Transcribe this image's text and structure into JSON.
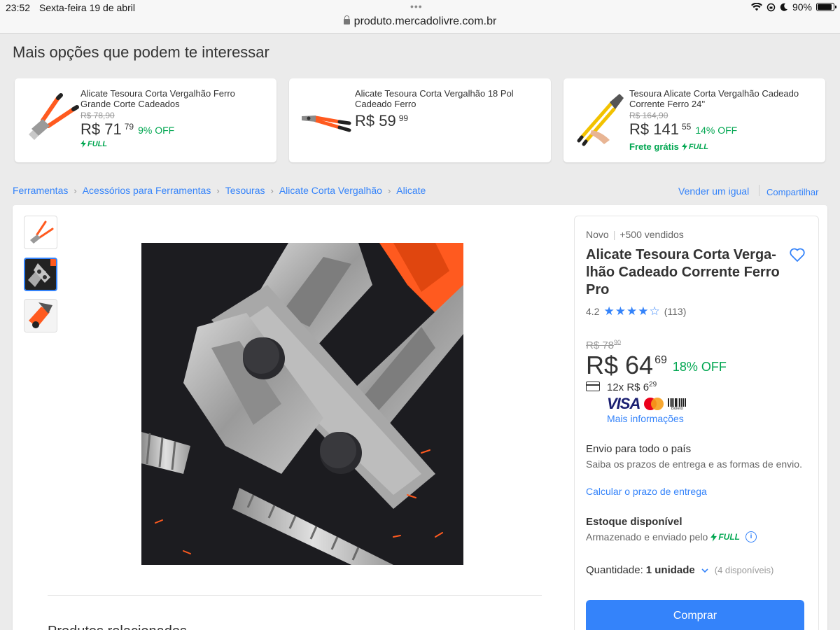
{
  "status_bar": {
    "time": "23:52",
    "date": "Sexta-feira 19 de abril",
    "battery": "90%",
    "battery_level": 0.9
  },
  "browser": {
    "url": "produto.mercadolivre.com.br"
  },
  "recommendations": {
    "title": "Mais opções que podem te interessar",
    "items": [
      {
        "title": "Alicate Tesoura Corta Vergalhão Ferro Grande Corte Cadeados",
        "old_price": "R$ 78,90",
        "price": "R$ 71",
        "cents": "79",
        "off": "9% OFF",
        "full": "FULL"
      },
      {
        "title": "Alicate Tesoura Corta Vergalhão 18 Pol Cadeado Ferro",
        "price": "R$ 59",
        "cents": "99"
      },
      {
        "title": "Tesoura Alicate Corta Vergalhão Cadeado Corrente Ferro 24''",
        "old_price": "R$ 164,90",
        "price": "R$ 141",
        "cents": "55",
        "off": "14% OFF",
        "frete": "Frete grátis",
        "full": "FULL"
      }
    ]
  },
  "breadcrumb": [
    "Ferramentas",
    "Acessórios para Ferramentas",
    "Tesouras",
    "Alicate Corta Vergalhão",
    "Alicate"
  ],
  "actions": {
    "sell": "Vender um igual",
    "share": "Compartilhar"
  },
  "product": {
    "condition": "Novo",
    "sold": "+500 vendidos",
    "title_lines": [
      "Alicate Tesoura Corta Verga-",
      "lhão Cadeado Corrente Ferro",
      "Pro"
    ],
    "rating": "4.2",
    "rating_value": 4.2,
    "reviews": "(113)",
    "old_price": "R$ 78",
    "old_cents": "90",
    "price": "R$ 64",
    "cents": "69",
    "off": "18% OFF",
    "installments": "12x R$ 6",
    "installments_cents": "29",
    "payment_methods": [
      "VISA",
      "mastercard",
      "Boleto"
    ],
    "more_info": "Mais informações",
    "shipping_title": "Envio para todo o país",
    "shipping_sub": "Saiba os prazos de entrega e as formas de envio.",
    "shipping_link": "Calcular o prazo de entrega",
    "stock_title": "Estoque disponível",
    "stock_sub": "Armazenado e enviado pelo",
    "full": "FULL",
    "qty_label": "Quantidade:",
    "qty_value": "1 unidade",
    "qty_available": "(4 disponíveis)",
    "buy_button": "Comprar",
    "below_section_title": "Produtos relacionados"
  },
  "colors": {
    "accent": "#3483fa",
    "green": "#00a650",
    "tool_orange": "#ff5a1f",
    "tool_yellow": "#f2c200"
  }
}
